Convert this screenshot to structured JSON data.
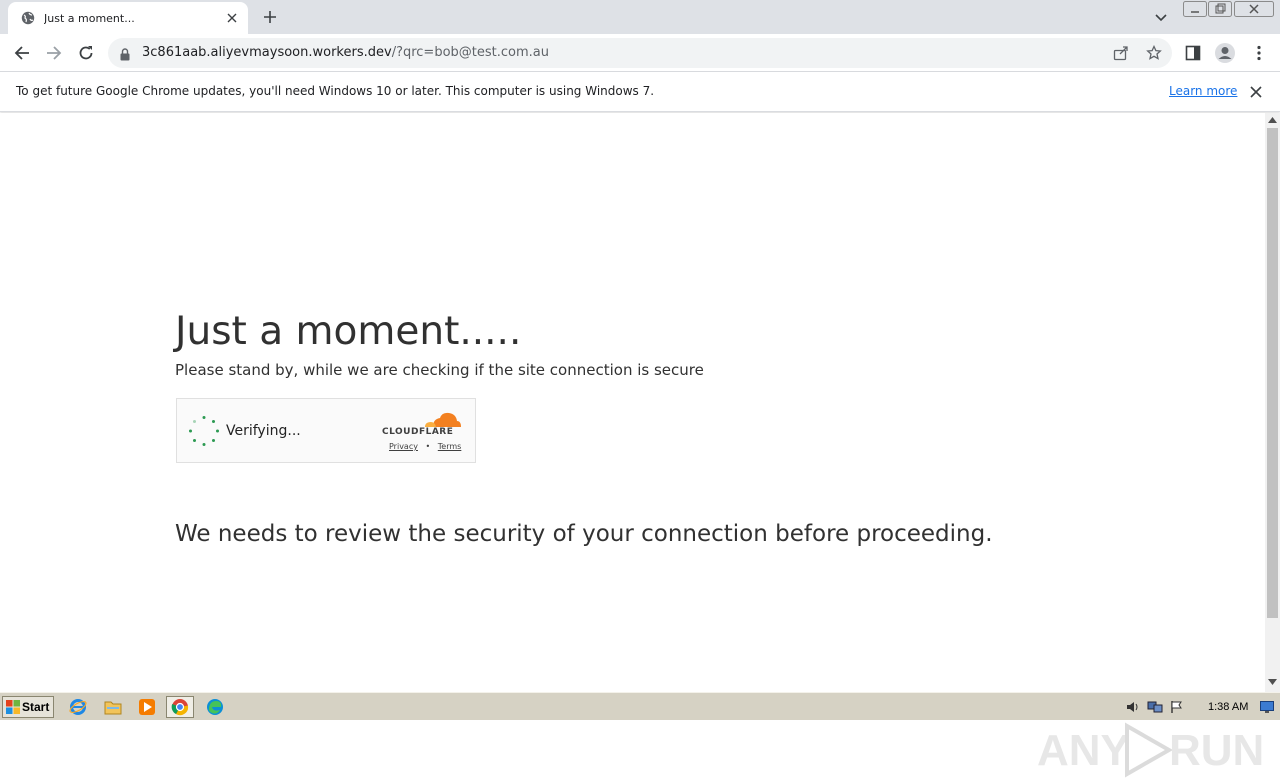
{
  "browser": {
    "tab": {
      "title": "Just a moment...",
      "favicon": "globe-icon"
    },
    "url": {
      "host": "3c861aab.aliyevmaysoon.workers.dev",
      "rest": "/?qrc=bob@test.com.au"
    }
  },
  "infobar": {
    "message": "To get future Google Chrome updates, you'll need Windows 10 or later. This computer is using Windows 7.",
    "learn_more": "Learn more"
  },
  "page": {
    "heading": "Just a moment.....",
    "subheading": "Please stand by, while we are checking if the site connection is secure",
    "widget": {
      "status": "Verifying...",
      "brand": "CLOUDFLARE",
      "privacy": "Privacy",
      "separator": "•",
      "terms": "Terms"
    },
    "review": "We needs to review the security of your connection before proceeding."
  },
  "watermark": {
    "left": "ANY",
    "right": "RUN"
  },
  "taskbar": {
    "start": "Start",
    "clock": "1:38 AM",
    "apps": [
      "ie-icon",
      "explorer-icon",
      "media-player-icon",
      "chrome-icon",
      "edge-icon"
    ]
  },
  "colors": {
    "cloudflare_orange": "#f38020",
    "link_blue": "#1a73e8",
    "spinner_green": "#2c9a52"
  }
}
